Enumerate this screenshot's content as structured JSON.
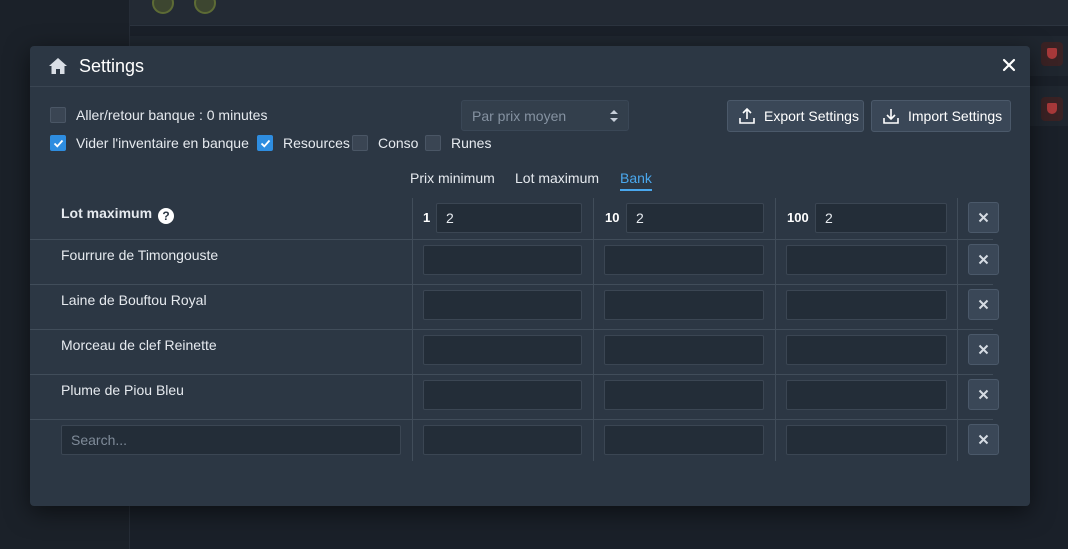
{
  "dialog": {
    "title": "Settings",
    "close_glyph": "×"
  },
  "options": {
    "bank_return": {
      "label": "Aller/retour banque : 0 minutes",
      "checked": false
    },
    "empty_inventory": {
      "label": "Vider l'inventaire en banque",
      "checked": true
    },
    "resources": {
      "label": "Resources",
      "checked": true
    },
    "conso": {
      "label": "Conso",
      "checked": false
    },
    "runes": {
      "label": "Runes",
      "checked": false
    }
  },
  "price_select": {
    "value": "Par prix moyen"
  },
  "buttons": {
    "export": "Export Settings",
    "import": "Import Settings"
  },
  "tabs": [
    {
      "label": "Prix minimum",
      "active": false
    },
    {
      "label": "Lot maximum",
      "active": false
    },
    {
      "label": "Bank",
      "active": true
    }
  ],
  "table": {
    "header_label": "Lot maximum",
    "help_glyph": "?",
    "lots": [
      {
        "qty": "1",
        "value": "2"
      },
      {
        "qty": "10",
        "value": "2"
      },
      {
        "qty": "100",
        "value": "2"
      }
    ],
    "rows": [
      {
        "name": "Fourrure de Timongouste"
      },
      {
        "name": "Laine de Bouftou Royal"
      },
      {
        "name": "Morceau de clef Reinette"
      },
      {
        "name": "Plume de Piou Bleu"
      }
    ],
    "search_placeholder": "Search..."
  },
  "colors": {
    "accent": "#2e8de0",
    "tab_active": "#4aa8ee",
    "modal_bg": "#2c3744"
  }
}
